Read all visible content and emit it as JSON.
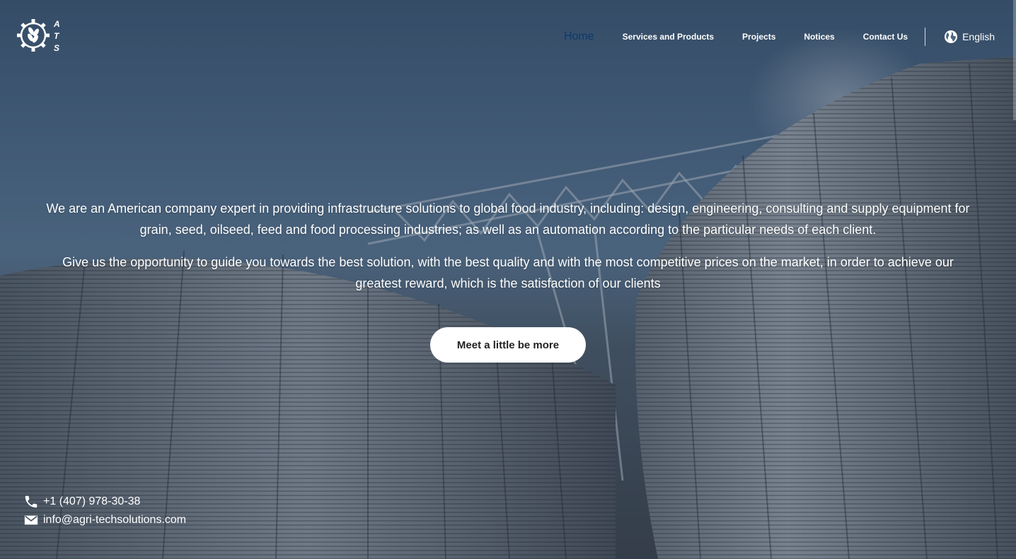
{
  "nav": {
    "items": [
      "Home",
      "Services and Products",
      "Projects",
      "Notices",
      "Contact Us"
    ],
    "active": "Home",
    "language": "English"
  },
  "logo": {
    "letters": "ATS",
    "icon": "gear-wheat-icon"
  },
  "hero": {
    "paragraph_1": "We are an American company expert in providing infrastructure solutions to global food industry, including: design, engineering, consulting and supply equipment for grain, seed, oilseed, feed and food processing industries; as well as an automation according to the particular needs of each client.",
    "paragraph_2": "Give us the opportunity to guide you towards the best solution, with the best quality and with the most competitive prices on the market, in order to achieve our greatest reward, which is the satisfaction of our clients",
    "cta_label": "Meet a little be more"
  },
  "contact": {
    "phone": "+1 (407) 978-30-38",
    "email": "info@agri-techsolutions.com",
    "phone_icon": "phone-icon",
    "email_icon": "mail-icon"
  },
  "colors": {
    "active_nav": "#0b3a6e",
    "button_bg": "#ffffff",
    "text": "#ffffff"
  }
}
